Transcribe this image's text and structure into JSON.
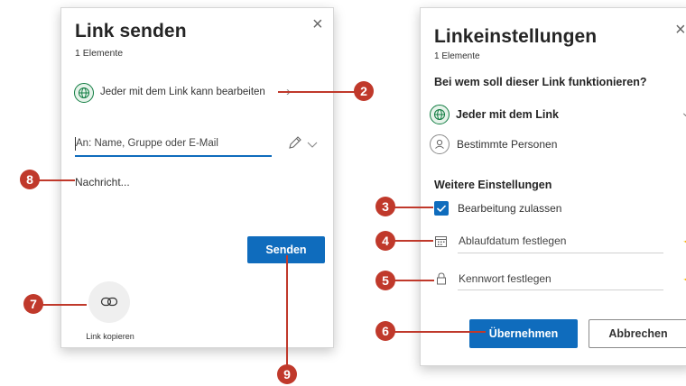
{
  "left_dialog": {
    "title": "Link senden",
    "item_count": "1 Elemente",
    "permission_text": "Jeder mit dem Link kann bearbeiten",
    "permission_chevron": "›",
    "to_placeholder": "An: Name, Gruppe oder E-Mail",
    "message_placeholder": "Nachricht...",
    "send_label": "Senden",
    "copy_link_label": "Link kopieren",
    "close_glyph": "×"
  },
  "right_dialog": {
    "title": "Linkeinstellungen",
    "item_count": "1 Elemente",
    "question": "Bei wem soll dieser Link funktionieren?",
    "option_anyone": "Jeder mit dem Link",
    "option_specific": "Bestimmte Personen",
    "more_settings": "Weitere Einstellungen",
    "allow_edit": "Bearbeitung zulassen",
    "expiry_placeholder": "Ablaufdatum festlegen",
    "password_placeholder": "Kennwort festlegen",
    "apply_label": "Übernehmen",
    "cancel_label": "Abbrechen",
    "close_glyph": "×",
    "chevron": "⌄",
    "premium_star": "✦"
  },
  "markers": [
    "2",
    "3",
    "4",
    "5",
    "6",
    "7",
    "8",
    "9"
  ],
  "colors": {
    "accent": "#0f6cbd",
    "marker": "#c0392b",
    "globe": "#107c41",
    "premium": "#f2b400"
  }
}
